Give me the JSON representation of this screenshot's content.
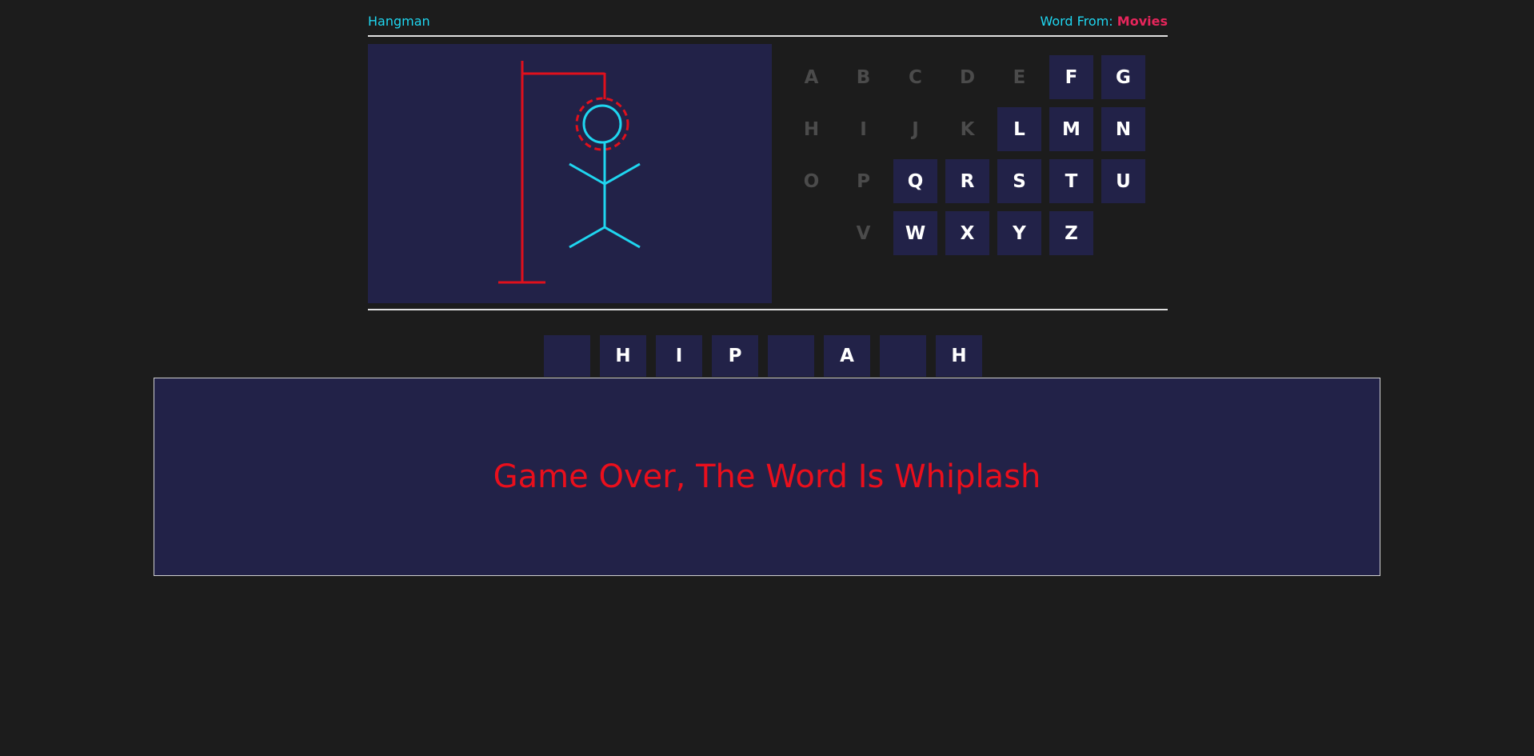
{
  "header": {
    "title": "Hangman",
    "word_from_label": "Word From:",
    "category": "Movies"
  },
  "colors": {
    "background": "#1c1c1c",
    "panel": "#222248",
    "cyan": "#1fd6f0",
    "red": "#e0101c",
    "category_pink": "#e6255b",
    "used_letter": "#4b4b4b"
  },
  "keyboard": {
    "rows": [
      [
        {
          "letter": "A",
          "used": true
        },
        {
          "letter": "B",
          "used": true
        },
        {
          "letter": "C",
          "used": true
        },
        {
          "letter": "D",
          "used": true
        },
        {
          "letter": "E",
          "used": true
        },
        {
          "letter": "F",
          "used": false
        },
        {
          "letter": "G",
          "used": false
        }
      ],
      [
        {
          "letter": "H",
          "used": true
        },
        {
          "letter": "I",
          "used": true
        },
        {
          "letter": "J",
          "used": true
        },
        {
          "letter": "K",
          "used": true
        },
        {
          "letter": "L",
          "used": false
        },
        {
          "letter": "M",
          "used": false
        },
        {
          "letter": "N",
          "used": false
        }
      ],
      [
        {
          "letter": "O",
          "used": true
        },
        {
          "letter": "P",
          "used": true
        },
        {
          "letter": "Q",
          "used": false
        },
        {
          "letter": "R",
          "used": false
        },
        {
          "letter": "S",
          "used": false
        },
        {
          "letter": "T",
          "used": false
        },
        {
          "letter": "U",
          "used": false
        }
      ],
      [
        {
          "letter": "",
          "used": true
        },
        {
          "letter": "V",
          "used": true
        },
        {
          "letter": "W",
          "used": false
        },
        {
          "letter": "X",
          "used": false
        },
        {
          "letter": "Y",
          "used": false
        },
        {
          "letter": "Z",
          "used": false
        }
      ]
    ]
  },
  "word_slots": [
    "",
    "H",
    "I",
    "P",
    "",
    "A",
    "",
    "H"
  ],
  "game_over": {
    "message": "Game Over, The Word Is Whiplash"
  },
  "hangman": {
    "wrong_guesses": 6,
    "max_wrong": 6
  }
}
